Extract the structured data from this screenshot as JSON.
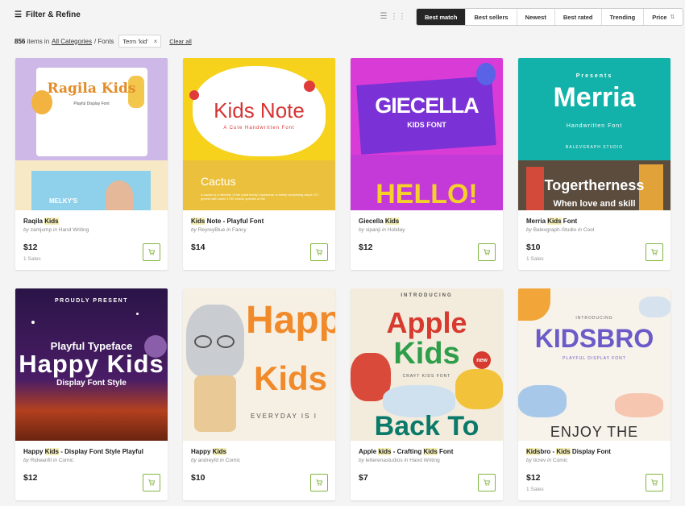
{
  "toolbar": {
    "filter_label": "Filter & Refine",
    "sort_options": [
      "Best match",
      "Best sellers",
      "Newest",
      "Best rated",
      "Trending",
      "Price"
    ],
    "active_sort": "Best match"
  },
  "summary": {
    "count": "856",
    "items_in": "items in",
    "category_link": "All Categories",
    "category_rest": "/ Fonts",
    "term_chip": "Term 'kid'",
    "clear_all": "Clear all"
  },
  "colors": {
    "accent_green": "#82b541",
    "active_sort_bg": "#262626",
    "highlight": "#f6f0b6"
  },
  "cards": [
    {
      "title_pre": "Raqila ",
      "title_hl": "Kids",
      "title_post": "",
      "author": "zamjump",
      "category": "Hand Writing",
      "price": "$12",
      "sales": "1 Sales",
      "thumb_texts": [
        "Ragila Kids",
        "Playful Display Font",
        "MELKY'S"
      ]
    },
    {
      "title_pre": "",
      "title_hl": "Kids",
      "title_post": " Note - Playful Font",
      "author": "ReyreyBlue",
      "category": "Fancy",
      "price": "$14",
      "sales": "",
      "thumb_texts": [
        "Kids Note",
        "A Cute Handwritten Font",
        "Cactus",
        "A cactus is a member of the plant family Cactaceae, a family comprising about 127 genera with some 1750 known species of the"
      ]
    },
    {
      "title_pre": "Giecella ",
      "title_hl": "Kids",
      "title_post": "",
      "author": "sipanji",
      "category": "Holiday",
      "price": "$12",
      "sales": "",
      "thumb_texts": [
        "GIECELLA",
        "KIDS FONT",
        "HELLO!"
      ]
    },
    {
      "title_pre": "Merria ",
      "title_hl": "Kids",
      "title_post": " Font",
      "author": "Balevgraph-Studio",
      "category": "Cool",
      "price": "$10",
      "sales": "1 Sales",
      "thumb_texts": [
        "Presents",
        "Merria",
        "Handwritten Font",
        "BALEVGRAPH STUDIO",
        "Togertherness",
        "When love and skill"
      ]
    },
    {
      "title_pre": "Happy ",
      "title_hl": "Kids",
      "title_post": " - Display Font Style Playful",
      "author": "Ridwanfil",
      "category": "Comic",
      "price": "$12",
      "sales": "",
      "thumb_texts": [
        "PROUDLY PRESENT",
        "Playful Typeface",
        "Happy Kids",
        "Display Font Style"
      ]
    },
    {
      "title_pre": "Happy ",
      "title_hl": "Kids",
      "title_post": "",
      "author": "andreyfd",
      "category": "Comic",
      "price": "$10",
      "sales": "",
      "thumb_texts": [
        "Happ",
        "Kids",
        "EVERYDAY IS I"
      ]
    },
    {
      "title_pre": "Apple ",
      "title_hl": "kids",
      "title_post": " - Crafting ",
      "title_hl2": "Kids",
      "title_post2": " Font",
      "author": "letterenastudios",
      "category": "Hand Writing",
      "price": "$7",
      "sales": "",
      "thumb_texts": [
        "INTRODUCING",
        "Apple",
        "Kids",
        "CRAFT KIDS FONT",
        "Back To",
        "new"
      ]
    },
    {
      "title_pre": "",
      "title_hl": "Kids",
      "title_post": "bro - ",
      "title_hl2": "Kids",
      "title_post2": " Display Font",
      "author": "ticrev",
      "category": "Comic",
      "price": "$12",
      "sales": "1 Sales",
      "thumb_texts": [
        "INTRODUCING",
        "KIDSBRO",
        "PLAYFUL DISPLAY FONT",
        "ENJOY THE"
      ]
    }
  ]
}
